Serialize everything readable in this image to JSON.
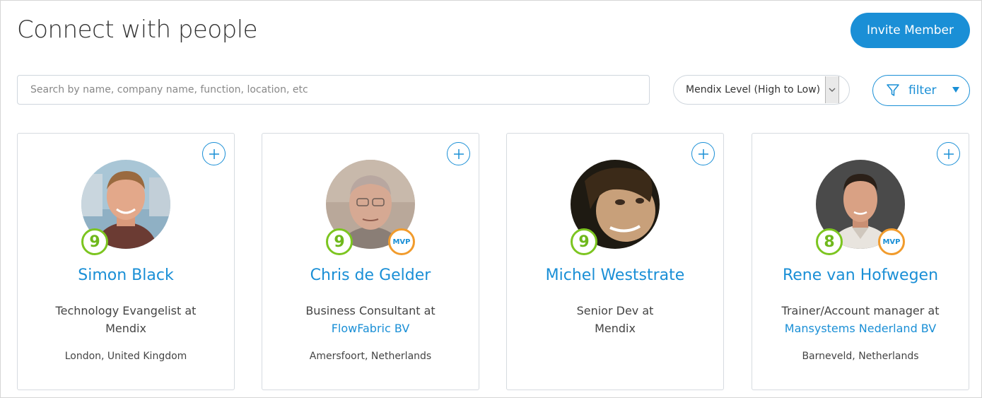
{
  "header": {
    "title": "Connect with people",
    "invite_label": "Invite Member"
  },
  "toolbar": {
    "search_placeholder": "Search by name, company name, function, location, etc",
    "sort_selected": "Mendix Level (High to Low)",
    "filter_label": "filter"
  },
  "colors": {
    "accent": "#1a8fd6",
    "level_badge": "#7cc520",
    "mvp_badge": "#f19b2c"
  },
  "members": [
    {
      "name": "Simon Black",
      "level": "9",
      "mvp": "",
      "role": "Technology Evangelist at",
      "company": "Mendix",
      "location": "London, United Kingdom"
    },
    {
      "name": "Chris de Gelder",
      "level": "9",
      "mvp": "MVP",
      "role": "Business Consultant at",
      "company": "FlowFabric BV",
      "location": "Amersfoort, Netherlands"
    },
    {
      "name": "Michel Weststrate",
      "level": "9",
      "mvp": "",
      "role": "Senior Dev at",
      "company": "Mendix",
      "location": ""
    },
    {
      "name": "Rene van Hofwegen",
      "level": "8",
      "mvp": "MVP",
      "role": "Trainer/Account manager at",
      "company": "Mansystems Nederland BV",
      "location": "Barneveld, Netherlands"
    }
  ],
  "icons": {
    "add": "plus-circle-icon",
    "filter": "funnel-icon",
    "sort_arrow": "chevron-down-icon"
  }
}
